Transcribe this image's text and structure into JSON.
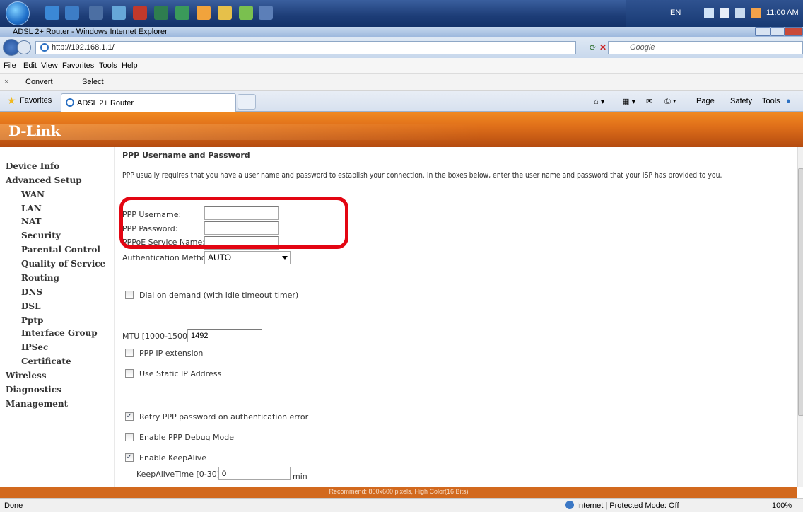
{
  "taskbar": {
    "lang": "EN",
    "time": "11:00 AM"
  },
  "window": {
    "title": "ADSL 2+ Router - Windows Internet Explorer"
  },
  "address_bar": {
    "url": "http://192.168.1.1/",
    "search_placeholder": "Google"
  },
  "menu": {
    "items": [
      "File",
      "Edit",
      "View",
      "Favorites",
      "Tools",
      "Help"
    ]
  },
  "command_bar": {
    "convert": "Convert",
    "select": "Select"
  },
  "favorites_bar": {
    "favorites": "Favorites",
    "tab_title": "ADSL 2+ Router",
    "page_menu": "Page",
    "safety_menu": "Safety",
    "tools_menu": "Tools"
  },
  "brand": {
    "logo": "D-Link"
  },
  "left_nav": [
    {
      "label": "Device Info"
    },
    {
      "label": "Advanced Setup"
    },
    {
      "label": "WAN"
    },
    {
      "label": "LAN"
    },
    {
      "label": "NAT"
    },
    {
      "label": "Security"
    },
    {
      "label": "Parental Control"
    },
    {
      "label": "Quality of Service"
    },
    {
      "label": "Routing"
    },
    {
      "label": "DNS"
    },
    {
      "label": "DSL"
    },
    {
      "label": "Pptp"
    },
    {
      "label": "Interface Group"
    },
    {
      "label": "IPSec"
    },
    {
      "label": "Certificate"
    },
    {
      "label": "Wireless"
    },
    {
      "label": "Diagnostics"
    },
    {
      "label": "Management"
    }
  ],
  "content": {
    "section_title": "PPP Username and Password",
    "description": "PPP usually requires that you have a user name and password to establish your connection. In the boxes below, enter the user name and password that your ISP has provided to you.",
    "ppp_username_label": "PPP Username:",
    "ppp_password_label": "PPP Password:",
    "pppoe_service_label": "PPPoE Service Name:",
    "auth_method_label": "Authentication Method:",
    "auth_method_value": "AUTO",
    "dial_on_demand_label": "Dial on demand (with idle timeout timer)",
    "mtu_label": "MTU [1000-1500]:",
    "mtu_value": "1492",
    "ppp_ip_ext_label": "PPP IP extension",
    "static_ip_label": "Use Static IP Address",
    "retry_label": "Retry PPP password on authentication error",
    "debug_label": "Enable PPP Debug Mode",
    "keepalive_label": "Enable KeepAlive",
    "keepalive_time_label": "KeepAliveTime [0-30]:",
    "keepalive_time_value": "0",
    "keepalive_unit": "min"
  },
  "footer": {
    "recommend": "Recommend: 800x600 pixels, High Color(16 Bits)"
  },
  "status_bar": {
    "status": "Done",
    "zone": "Internet | Protected Mode: Off",
    "zoom": "100%"
  }
}
